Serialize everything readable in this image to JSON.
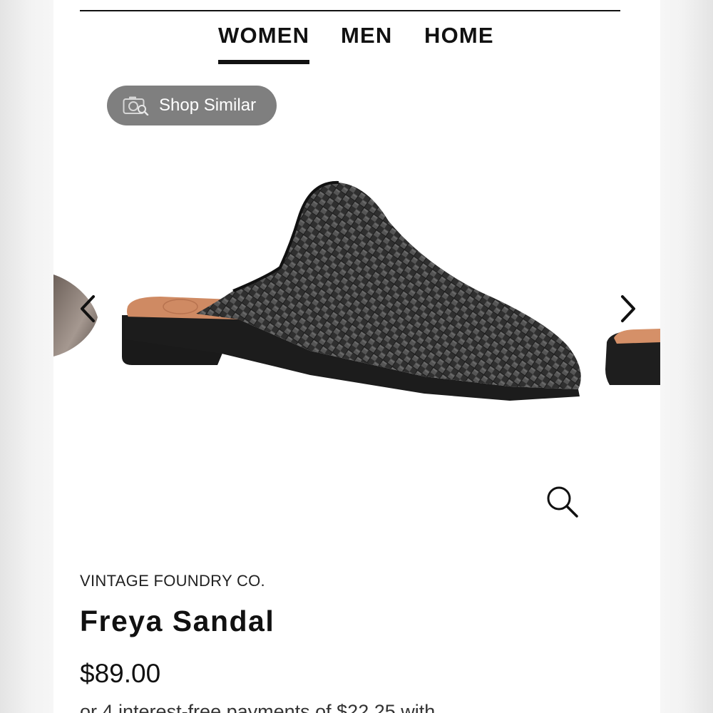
{
  "nav": {
    "tabs": [
      {
        "label": "WOMEN",
        "active": true
      },
      {
        "label": "MEN",
        "active": false
      },
      {
        "label": "HOME",
        "active": false
      }
    ]
  },
  "shop_similar": {
    "label": "Shop Similar",
    "icon": "camera-search-icon"
  },
  "carousel": {
    "prev_icon": "chevron-left-icon",
    "next_icon": "chevron-right-icon",
    "zoom_icon": "zoom-icon"
  },
  "product": {
    "brand": "VINTAGE FOUNDRY CO.",
    "name": "Freya Sandal",
    "price": "$89.00",
    "installment": "or 4 interest-free payments of $22.25 with"
  },
  "colors": {
    "shoe": "#2b2b2b",
    "footbed": "#d9916a",
    "pill": "#7f7f7f"
  }
}
